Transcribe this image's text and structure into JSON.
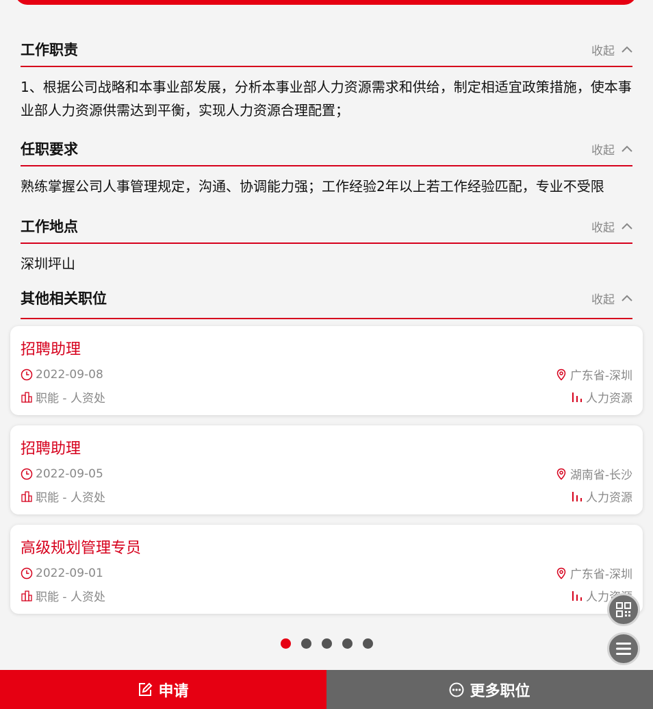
{
  "sections": {
    "duties": {
      "title": "工作职责",
      "toggle": "收起",
      "body": "1、根据公司战略和本事业部发展，分析本事业部人力资源需求和供给，制定相适宜政策措施，使本事业部人力资源供需达到平衡，实现人力资源合理配置；"
    },
    "requirements": {
      "title": "任职要求",
      "toggle": "收起",
      "body": "熟练掌握公司人事管理规定，沟通、协调能力强；工作经验2年以上若工作经验匹配，专业不受限"
    },
    "location": {
      "title": "工作地点",
      "toggle": "收起",
      "body": "深圳坪山"
    },
    "related": {
      "title": "其他相关职位",
      "toggle": "收起"
    }
  },
  "jobs": [
    {
      "title": "招聘助理",
      "date": "2022-09-08",
      "place": "广东省-深圳",
      "dept": "职能 - 人资处",
      "category": "人力资源"
    },
    {
      "title": "招聘助理",
      "date": "2022-09-05",
      "place": "湖南省-长沙",
      "dept": "职能 - 人资处",
      "category": "人力资源"
    },
    {
      "title": "高级规划管理专员",
      "date": "2022-09-01",
      "place": "广东省-深圳",
      "dept": "职能 - 人资处",
      "category": "人力资源"
    }
  ],
  "pagination": {
    "total": 5,
    "active": 1
  },
  "bottom": {
    "apply_label": "申请",
    "more_label": "更多职位"
  },
  "colors": {
    "brand": "#e60012",
    "gray_button": "#666666",
    "muted_text": "#888888"
  },
  "icons": [
    "clock-icon",
    "location-pin-icon",
    "building-icon",
    "bar-chart-icon",
    "chevron-up-icon",
    "qr-code-icon",
    "menu-icon",
    "edit-icon",
    "more-dots-icon"
  ]
}
